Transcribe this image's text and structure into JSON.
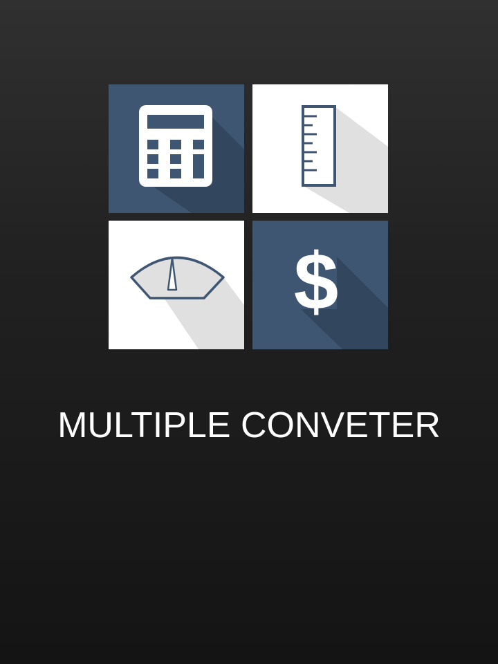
{
  "app": {
    "title": "MULTIPLE CONVETER"
  },
  "logo": {
    "tiles": [
      {
        "name": "calculator",
        "icon": "calculator-icon",
        "background": "#3f5672",
        "foreground": "#ffffff"
      },
      {
        "name": "ruler",
        "icon": "ruler-icon",
        "background": "#ffffff",
        "foreground": "#3f5672"
      },
      {
        "name": "scale",
        "icon": "scale-gauge-icon",
        "background": "#ffffff",
        "foreground": "#3f5672"
      },
      {
        "name": "currency",
        "icon": "dollar-icon",
        "background": "#3f5672",
        "foreground": "#ffffff"
      }
    ],
    "dollar_glyph": "$"
  },
  "colors": {
    "accent_dark": "#3f5672",
    "shadow_dark": "#32465e",
    "shadow_light": "#e0e0e0",
    "text": "#ffffff"
  }
}
